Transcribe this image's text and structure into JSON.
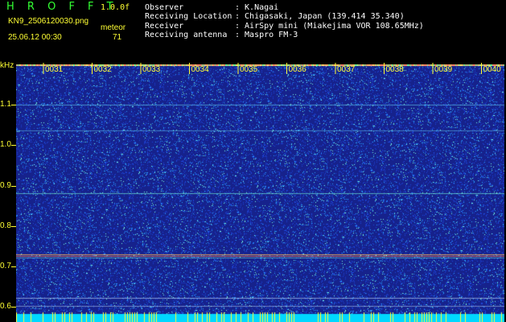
{
  "header": {
    "app_title": "H R O F F T",
    "version": "1.0.0f",
    "filename": "KN9_2506120030.png",
    "meteor_label": "meteor",
    "datetime": "25.06.12 00:30",
    "meteor_count": "71"
  },
  "meta": [
    {
      "key": "Observer",
      "value": ": K.Nagai"
    },
    {
      "key": "Receiving Location",
      "value": ": Chigasaki, Japan (139.414 35.340)"
    },
    {
      "key": "Receiver",
      "value": ": AirSpy mini (Miakejima VOR 108.65MHz)"
    },
    {
      "key": "Receiving antenna",
      "value": ": Maspro FM-3"
    }
  ],
  "axis": {
    "unit": "kHz",
    "y_ticks": [
      "1.1",
      "1.0",
      "0.9",
      "0.8",
      "0.7",
      "0.6"
    ],
    "time_ticks": [
      "0031",
      "0032",
      "0033",
      "0034",
      "0035",
      "0036",
      "0037",
      "0038",
      "0039",
      "0040"
    ]
  },
  "colors": {
    "background": "#1a237e",
    "text_yellow": "#ffff33",
    "title_green": "#33ff33",
    "bottom_band": "#00e5ff"
  }
}
